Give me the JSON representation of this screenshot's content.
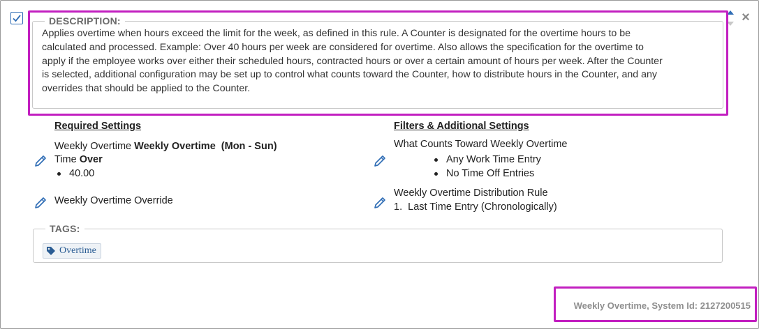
{
  "header": {
    "checkbox_checked": true,
    "icons": [
      "checkbox-checked-icon",
      "sort-icon",
      "close-icon"
    ],
    "close_glyph": "×"
  },
  "description": {
    "legend": "DESCRIPTION:",
    "lines": [
      "Applies overtime when hours exceed the limit for the week, as defined in this rule. A Counter is designated for the overtime hours to be",
      "calculated and processed. Example: Over 40 hours per week are considered for overtime. Also allows the specification for the overtime to",
      "apply if the employee works over either their scheduled hours, contracted hours or over a certain amount of hours per week. After the Counter",
      "is selected, additional configuration may be set up to control what counts toward the Counter, how to distribute hours in the Counter, and any",
      "overrides that should be applied to the Counter."
    ]
  },
  "required_settings": {
    "title": "Required Settings",
    "overtime_prefix": "Weekly Overtime",
    "overtime_name": "Weekly Overtime",
    "overtime_days": "(Mon - Sun)",
    "time_label": "Time",
    "time_qualifier": "Over",
    "value": "40.00",
    "override_label": "Weekly Overtime Override"
  },
  "filters": {
    "title": "Filters & Additional Settings",
    "counts_label": "What Counts Toward Weekly Overtime",
    "counts_items": [
      "Any Work Time Entry",
      "No Time Off Entries"
    ],
    "distribution_label": "Weekly Overtime Distribution Rule",
    "distribution_item_number": "1.",
    "distribution_item": "Last Time Entry (Chronologically)"
  },
  "tags": {
    "legend": "TAGS:",
    "items": [
      "Overtime"
    ]
  },
  "footer": {
    "system_text": "Weekly Overtime, System Id: 2127200515"
  },
  "colors": {
    "highlight": "#c21fc0",
    "accent_blue": "#2f6db5",
    "tag_text": "#2b5d94"
  }
}
